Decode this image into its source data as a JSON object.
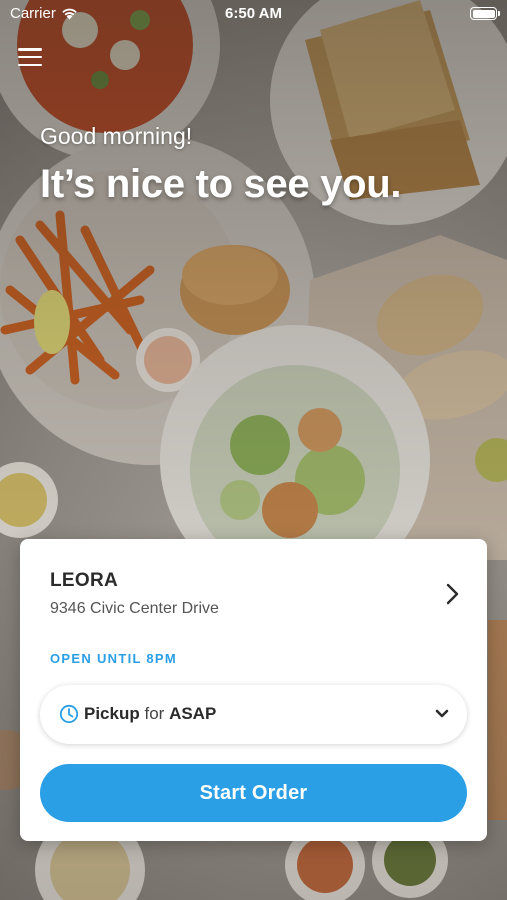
{
  "status_bar": {
    "carrier": "Carrier",
    "time": "6:50 AM"
  },
  "header": {
    "greeting": "Good morning!",
    "headline": "It’s nice to see you."
  },
  "store_card": {
    "name": "LEORA",
    "address": "9346 Civic Center Drive",
    "hours": "OPEN UNTIL 8PM",
    "order_type": {
      "mode": "Pickup",
      "connector": "for",
      "time": "ASAP"
    },
    "start_button": "Start Order"
  },
  "colors": {
    "accent": "#2a9fe6",
    "card_bg": "#ffffff",
    "text_dark": "#2b2b2b"
  },
  "icons": {
    "menu": "hamburger-menu-icon",
    "wifi": "wifi-icon",
    "battery": "battery-icon",
    "store_chevron": "chevron-right-icon",
    "clock": "clock-icon",
    "dropdown": "chevron-down-icon"
  }
}
